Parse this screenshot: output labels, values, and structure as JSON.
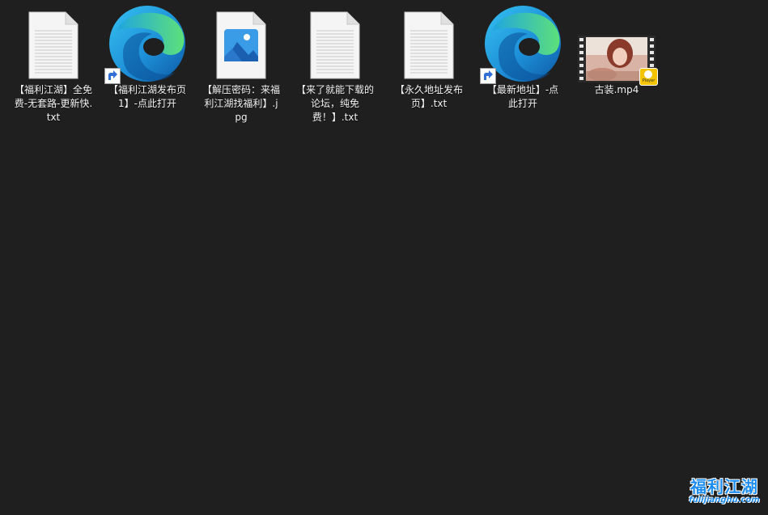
{
  "desktop": {
    "files": [
      {
        "label": "【福利江湖】全免费-无套路-更新快.txt",
        "icon": "text-file-icon"
      },
      {
        "label": "【福利江湖发布页1】-点此打开",
        "icon": "edge-browser-icon",
        "shortcut": true
      },
      {
        "label": "【解压密码：来福利江湖找福利】.jpg",
        "icon": "image-file-icon"
      },
      {
        "label": "【来了就能下载的论坛，纯免费！】.txt",
        "icon": "text-file-icon"
      },
      {
        "label": "【永久地址发布页】.txt",
        "icon": "text-file-icon"
      },
      {
        "label": "【最新地址】-点此打开",
        "icon": "edge-browser-icon",
        "shortcut": true
      },
      {
        "label": "古装.mp4",
        "icon": "video-file-icon",
        "badge": "Player"
      }
    ]
  },
  "watermark": {
    "title": "福利江湖",
    "subtitle": "fulijianghu.com"
  },
  "colors": {
    "background": "#1f1f1f",
    "label_text": "#f2f2f2",
    "watermark_blue": "#1e8df0"
  }
}
